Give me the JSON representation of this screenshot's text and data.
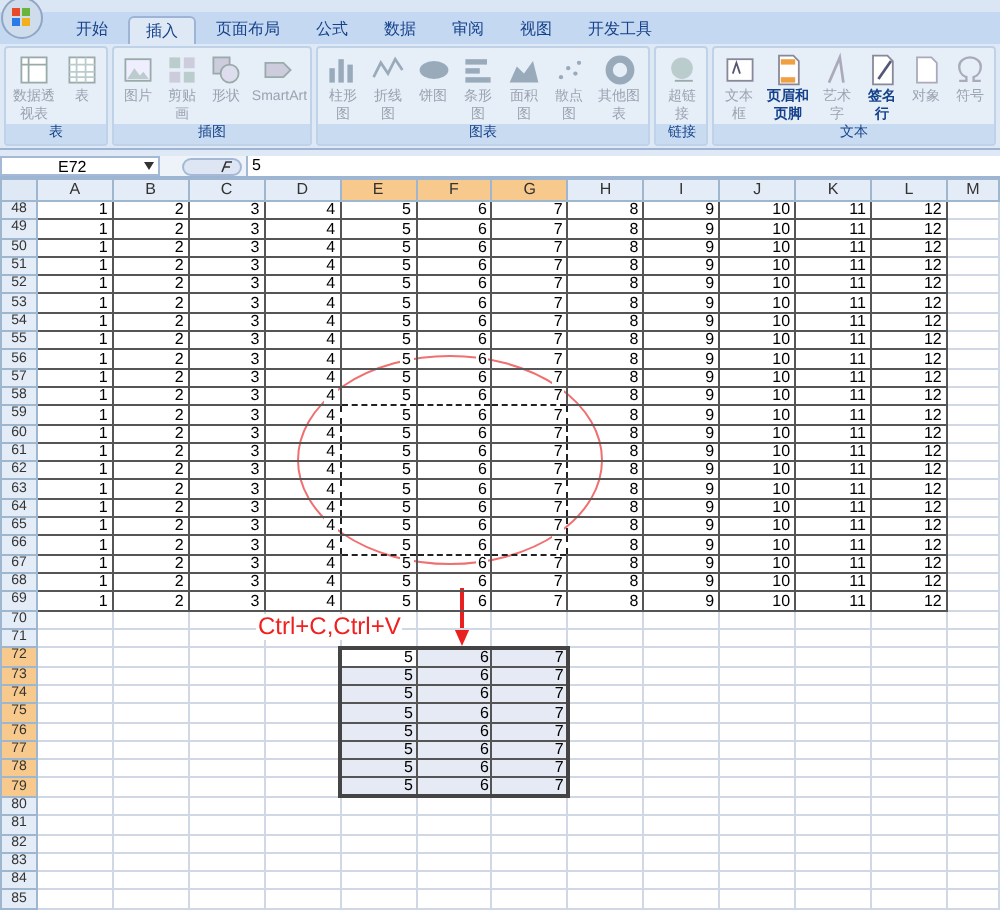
{
  "ribbon": {
    "tabs": [
      {
        "label": "开始",
        "selected": false
      },
      {
        "label": "插入",
        "selected": true
      },
      {
        "label": "页面布局",
        "selected": false
      },
      {
        "label": "公式",
        "selected": false
      },
      {
        "label": "数据",
        "selected": false
      },
      {
        "label": "审阅",
        "selected": false
      },
      {
        "label": "视图",
        "selected": false
      },
      {
        "label": "开发工具",
        "selected": false
      }
    ],
    "groups": [
      {
        "label": "表",
        "items": [
          {
            "label": "数据透视表",
            "disabled": true
          },
          {
            "label": "表",
            "disabled": true
          }
        ]
      },
      {
        "label": "插图",
        "items": [
          {
            "label": "图片",
            "disabled": true
          },
          {
            "label": "剪贴画",
            "disabled": true
          },
          {
            "label": "形状",
            "disabled": true
          },
          {
            "label": "SmartArt",
            "disabled": true
          }
        ]
      },
      {
        "label": "图表",
        "items": [
          {
            "label": "柱形图",
            "disabled": true
          },
          {
            "label": "折线图",
            "disabled": true
          },
          {
            "label": "饼图",
            "disabled": true
          },
          {
            "label": "条形图",
            "disabled": true
          },
          {
            "label": "面积图",
            "disabled": true
          },
          {
            "label": "散点图",
            "disabled": true
          },
          {
            "label": "其他图表",
            "disabled": true
          }
        ]
      },
      {
        "label": "链接",
        "items": [
          {
            "label": "超链接",
            "disabled": true
          }
        ]
      },
      {
        "label": "文本",
        "items": [
          {
            "label": "文本框",
            "disabled": true
          },
          {
            "label": "页眉和页脚",
            "disabled": false
          },
          {
            "label": "艺术字",
            "disabled": true
          },
          {
            "label": "签名行",
            "disabled": false
          },
          {
            "label": "对象",
            "disabled": true
          },
          {
            "label": "符号",
            "disabled": true
          }
        ]
      }
    ]
  },
  "formula_bar": {
    "name_box": "E72",
    "value": "5"
  },
  "columns": [
    {
      "label": "A",
      "selected": false
    },
    {
      "label": "B",
      "selected": false
    },
    {
      "label": "C",
      "selected": false
    },
    {
      "label": "D",
      "selected": false
    },
    {
      "label": "E",
      "selected": true
    },
    {
      "label": "F",
      "selected": true
    },
    {
      "label": "G",
      "selected": true
    },
    {
      "label": "H",
      "selected": false
    },
    {
      "label": "I",
      "selected": false
    },
    {
      "label": "J",
      "selected": false
    },
    {
      "label": "K",
      "selected": false
    },
    {
      "label": "L",
      "selected": false
    },
    {
      "label": "M",
      "selected": false
    }
  ],
  "rows": [
    {
      "number": "48",
      "selected": false,
      "copied": false,
      "cells": [
        "1",
        "2",
        "3",
        "4",
        "5",
        "6",
        "7",
        "8",
        "9",
        "10",
        "11",
        "12"
      ]
    },
    {
      "number": "49",
      "selected": false,
      "copied": false,
      "cells": [
        "1",
        "2",
        "3",
        "4",
        "5",
        "6",
        "7",
        "8",
        "9",
        "10",
        "11",
        "12"
      ]
    },
    {
      "number": "50",
      "selected": false,
      "copied": false,
      "cells": [
        "1",
        "2",
        "3",
        "4",
        "5",
        "6",
        "7",
        "8",
        "9",
        "10",
        "11",
        "12"
      ]
    },
    {
      "number": "51",
      "selected": false,
      "copied": false,
      "cells": [
        "1",
        "2",
        "3",
        "4",
        "5",
        "6",
        "7",
        "8",
        "9",
        "10",
        "11",
        "12"
      ]
    },
    {
      "number": "52",
      "selected": false,
      "copied": false,
      "cells": [
        "1",
        "2",
        "3",
        "4",
        "5",
        "6",
        "7",
        "8",
        "9",
        "10",
        "11",
        "12"
      ]
    },
    {
      "number": "53",
      "selected": false,
      "copied": false,
      "cells": [
        "1",
        "2",
        "3",
        "4",
        "5",
        "6",
        "7",
        "8",
        "9",
        "10",
        "11",
        "12"
      ]
    },
    {
      "number": "54",
      "selected": false,
      "copied": false,
      "cells": [
        "1",
        "2",
        "3",
        "4",
        "5",
        "6",
        "7",
        "8",
        "9",
        "10",
        "11",
        "12"
      ]
    },
    {
      "number": "55",
      "selected": false,
      "copied": false,
      "cells": [
        "1",
        "2",
        "3",
        "4",
        "5",
        "6",
        "7",
        "8",
        "9",
        "10",
        "11",
        "12"
      ]
    },
    {
      "number": "56",
      "selected": false,
      "copied": false,
      "cells": [
        "1",
        "2",
        "3",
        "4",
        "5",
        "6",
        "7",
        "8",
        "9",
        "10",
        "11",
        "12"
      ]
    },
    {
      "number": "57",
      "selected": false,
      "copied": false,
      "cells": [
        "1",
        "2",
        "3",
        "4",
        "5",
        "6",
        "7",
        "8",
        "9",
        "10",
        "11",
        "12"
      ]
    },
    {
      "number": "58",
      "selected": false,
      "copied": false,
      "cells": [
        "1",
        "2",
        "3",
        "4",
        "5",
        "6",
        "7",
        "8",
        "9",
        "10",
        "11",
        "12"
      ]
    },
    {
      "number": "59",
      "selected": false,
      "copied": true,
      "cells": [
        "1",
        "2",
        "3",
        "4",
        "5",
        "6",
        "7",
        "8",
        "9",
        "10",
        "11",
        "12"
      ]
    },
    {
      "number": "60",
      "selected": false,
      "copied": true,
      "cells": [
        "1",
        "2",
        "3",
        "4",
        "5",
        "6",
        "7",
        "8",
        "9",
        "10",
        "11",
        "12"
      ]
    },
    {
      "number": "61",
      "selected": false,
      "copied": true,
      "cells": [
        "1",
        "2",
        "3",
        "4",
        "5",
        "6",
        "7",
        "8",
        "9",
        "10",
        "11",
        "12"
      ]
    },
    {
      "number": "62",
      "selected": false,
      "copied": true,
      "cells": [
        "1",
        "2",
        "3",
        "4",
        "5",
        "6",
        "7",
        "8",
        "9",
        "10",
        "11",
        "12"
      ]
    },
    {
      "number": "63",
      "selected": false,
      "copied": true,
      "cells": [
        "1",
        "2",
        "3",
        "4",
        "5",
        "6",
        "7",
        "8",
        "9",
        "10",
        "11",
        "12"
      ]
    },
    {
      "number": "64",
      "selected": false,
      "copied": true,
      "cells": [
        "1",
        "2",
        "3",
        "4",
        "5",
        "6",
        "7",
        "8",
        "9",
        "10",
        "11",
        "12"
      ]
    },
    {
      "number": "65",
      "selected": false,
      "copied": true,
      "cells": [
        "1",
        "2",
        "3",
        "4",
        "5",
        "6",
        "7",
        "8",
        "9",
        "10",
        "11",
        "12"
      ]
    },
    {
      "number": "66",
      "selected": false,
      "copied": true,
      "cells": [
        "1",
        "2",
        "3",
        "4",
        "5",
        "6",
        "7",
        "8",
        "9",
        "10",
        "11",
        "12"
      ]
    },
    {
      "number": "67",
      "selected": false,
      "copied": false,
      "cells": [
        "1",
        "2",
        "3",
        "4",
        "5",
        "6",
        "7",
        "8",
        "9",
        "10",
        "11",
        "12"
      ]
    },
    {
      "number": "68",
      "selected": false,
      "copied": false,
      "cells": [
        "1",
        "2",
        "3",
        "4",
        "5",
        "6",
        "7",
        "8",
        "9",
        "10",
        "11",
        "12"
      ]
    },
    {
      "number": "69",
      "selected": false,
      "copied": false,
      "cells": [
        "1",
        "2",
        "3",
        "4",
        "5",
        "6",
        "7",
        "8",
        "9",
        "10",
        "11",
        "12"
      ]
    },
    {
      "number": "70",
      "selected": false,
      "copied": false
    },
    {
      "number": "71",
      "selected": false,
      "copied": false
    },
    {
      "number": "72",
      "selected": true,
      "active": true,
      "copied": false,
      "cells": [
        null,
        null,
        null,
        null,
        "5",
        "6",
        "7"
      ]
    },
    {
      "number": "73",
      "selected": true,
      "copied": false,
      "cells": [
        null,
        null,
        null,
        null,
        "5",
        "6",
        "7"
      ]
    },
    {
      "number": "74",
      "selected": true,
      "copied": false,
      "cells": [
        null,
        null,
        null,
        null,
        "5",
        "6",
        "7"
      ]
    },
    {
      "number": "75",
      "selected": true,
      "copied": false,
      "cells": [
        null,
        null,
        null,
        null,
        "5",
        "6",
        "7"
      ]
    },
    {
      "number": "76",
      "selected": true,
      "copied": false,
      "cells": [
        null,
        null,
        null,
        null,
        "5",
        "6",
        "7"
      ]
    },
    {
      "number": "77",
      "selected": true,
      "copied": false,
      "cells": [
        null,
        null,
        null,
        null,
        "5",
        "6",
        "7"
      ]
    },
    {
      "number": "78",
      "selected": true,
      "copied": false,
      "cells": [
        null,
        null,
        null,
        null,
        "5",
        "6",
        "7"
      ]
    },
    {
      "number": "79",
      "selected": true,
      "copied": false,
      "cells": [
        null,
        null,
        null,
        null,
        "5",
        "6",
        "7"
      ]
    },
    {
      "number": "80",
      "selected": false,
      "copied": false
    },
    {
      "number": "81",
      "selected": false,
      "copied": false
    },
    {
      "number": "82",
      "selected": false,
      "copied": false
    },
    {
      "number": "83",
      "selected": false,
      "copied": false
    },
    {
      "number": "84",
      "selected": false,
      "copied": false
    },
    {
      "number": "85",
      "selected": false,
      "copied": false
    }
  ],
  "annotation": {
    "text": "Ctrl+C,Ctrl+V"
  }
}
